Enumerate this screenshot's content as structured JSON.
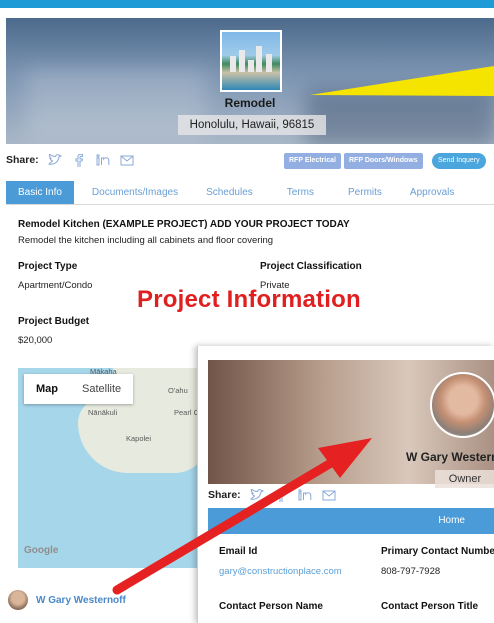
{
  "hero": {
    "title": "Remodel",
    "address": "Honolulu, Hawaii, 96815"
  },
  "share": {
    "label": "Share:",
    "icons": [
      "twitter-icon",
      "facebook-icon",
      "linkedin-icon",
      "mail-icon"
    ]
  },
  "actions": {
    "rfp_electrical": "RFP Electrical",
    "rfp_doors_windows": "RFP Doors/Windows",
    "send_inquiry": "Send Inquery"
  },
  "tabs": [
    {
      "label": "Basic Info",
      "active": true
    },
    {
      "label": "Documents/Images",
      "active": false
    },
    {
      "label": "Schedules",
      "active": false
    },
    {
      "label": "Terms",
      "active": false
    },
    {
      "label": "Permits",
      "active": false
    },
    {
      "label": "Approvals",
      "active": false
    }
  ],
  "project": {
    "title": "Remodel Kitchen (EXAMPLE PROJECT) ADD YOUR PROJECT TODAY",
    "description": "Remodel the kitchen including all cabinets and floor covering",
    "type_label": "Project Type",
    "type_value": "Apartment/Condo",
    "classification_label": "Project Classification",
    "classification_value": "Private",
    "budget_label": "Project Budget",
    "budget_value": "$20,000"
  },
  "overlay": {
    "title": "Project Information"
  },
  "map": {
    "tab_map": "Map",
    "tab_satellite": "Satellite",
    "labels": {
      "mikaha": "Mākaha",
      "oahu": "O'ahu",
      "nanakuli": "Nānākuli",
      "pearl": "Pearl C",
      "kapolei": "Kapolei"
    },
    "google": "Google"
  },
  "owner": {
    "name": "W Gary Westernoff"
  },
  "profile": {
    "name": "W Gary Westerno",
    "role": "Owner",
    "home_label": "Home",
    "email_label": "Email Id",
    "email_value": "gary@constructionplace.com",
    "primary_contact_label": "Primary Contact Numbe",
    "primary_contact_value": "808-797-7928",
    "contact_person_label": "Contact Person Name",
    "contact_title_label": "Contact Person Title"
  },
  "colors": {
    "accent": "#4a9bd8",
    "link": "#5a9fd6",
    "highlight_red": "#e02020",
    "beam_yellow": "#f5e300"
  }
}
